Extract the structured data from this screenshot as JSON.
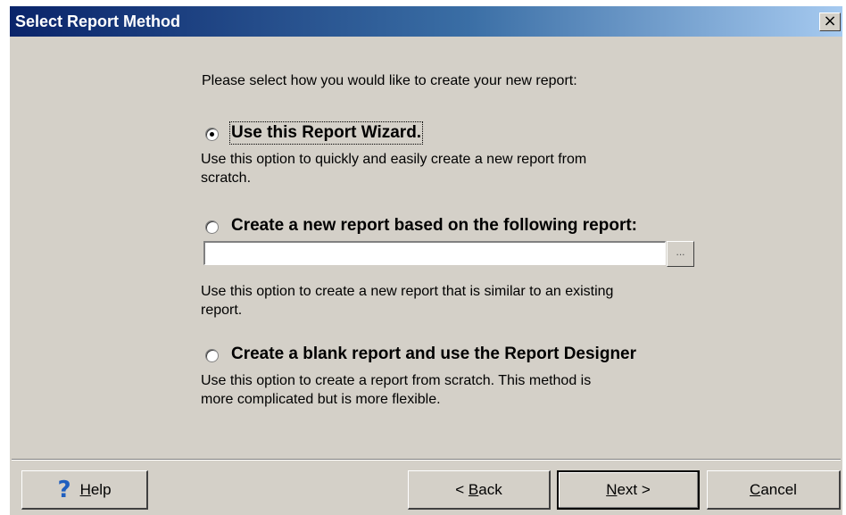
{
  "window": {
    "title": "Select Report Method",
    "close_glyph": "×"
  },
  "prompt": "Please select how you would like to create your new report:",
  "options": [
    {
      "label": "Use this Report Wizard.",
      "description_line1": "Use this option to quickly and easily create a new report from",
      "description_line2": "scratch.",
      "selected": true
    },
    {
      "label": "Create a new report based on the following report:",
      "description_line1": "Use this option to create a new report that is similar to an existing",
      "description_line2": "report.",
      "selected": false,
      "report_path_value": "",
      "browse_label": "..."
    },
    {
      "label": "Create a blank report and use the Report Designer",
      "description_line1": "Use this option to create a report from scratch.  This method is",
      "description_line2": "more complicated but is more flexible.",
      "selected": false
    }
  ],
  "buttons": {
    "help": {
      "icon": "question-mark-icon",
      "glyph": "?",
      "accel": "H",
      "rest": "elp"
    },
    "back": {
      "prefix": "< ",
      "accel": "B",
      "rest": "ack"
    },
    "next": {
      "accel": "N",
      "rest": "ext >"
    },
    "cancel": {
      "accel": "C",
      "rest": "ancel"
    }
  }
}
